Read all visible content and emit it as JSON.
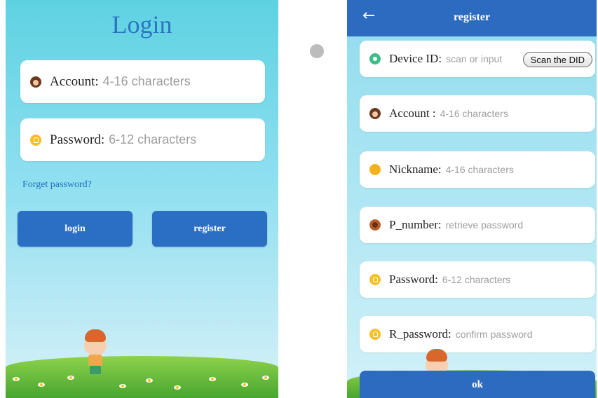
{
  "login": {
    "title": "Login",
    "account_label": "Account:",
    "account_placeholder": "4-16 characters",
    "password_label": "Password:",
    "password_placeholder": "6-12 characters",
    "forget": "Forget password?",
    "login_button": "login",
    "register_button": "register",
    "colors": {
      "accent": "#2a6fc4",
      "title": "#2a74c0"
    }
  },
  "register": {
    "title": "register",
    "back_icon": "←",
    "fields": [
      {
        "label": "Device ID:",
        "placeholder": "scan or input",
        "icon": "location-icon"
      },
      {
        "label": "Account :",
        "placeholder": "4-16 characters",
        "icon": "avatar-icon"
      },
      {
        "label": "Nickname:",
        "placeholder": "4-16 characters",
        "icon": "nickname-icon"
      },
      {
        "label": "P_number:",
        "placeholder": "retrieve password",
        "icon": "phone-icon"
      },
      {
        "label": "Password:",
        "placeholder": "6-12 characters",
        "icon": "lock-icon"
      },
      {
        "label": "R_password:",
        "placeholder": "confirm password",
        "icon": "lock-icon"
      }
    ],
    "scan_button": "Scan the DID",
    "ok_button": "ok",
    "colors": {
      "header": "#2c6bbf"
    }
  }
}
